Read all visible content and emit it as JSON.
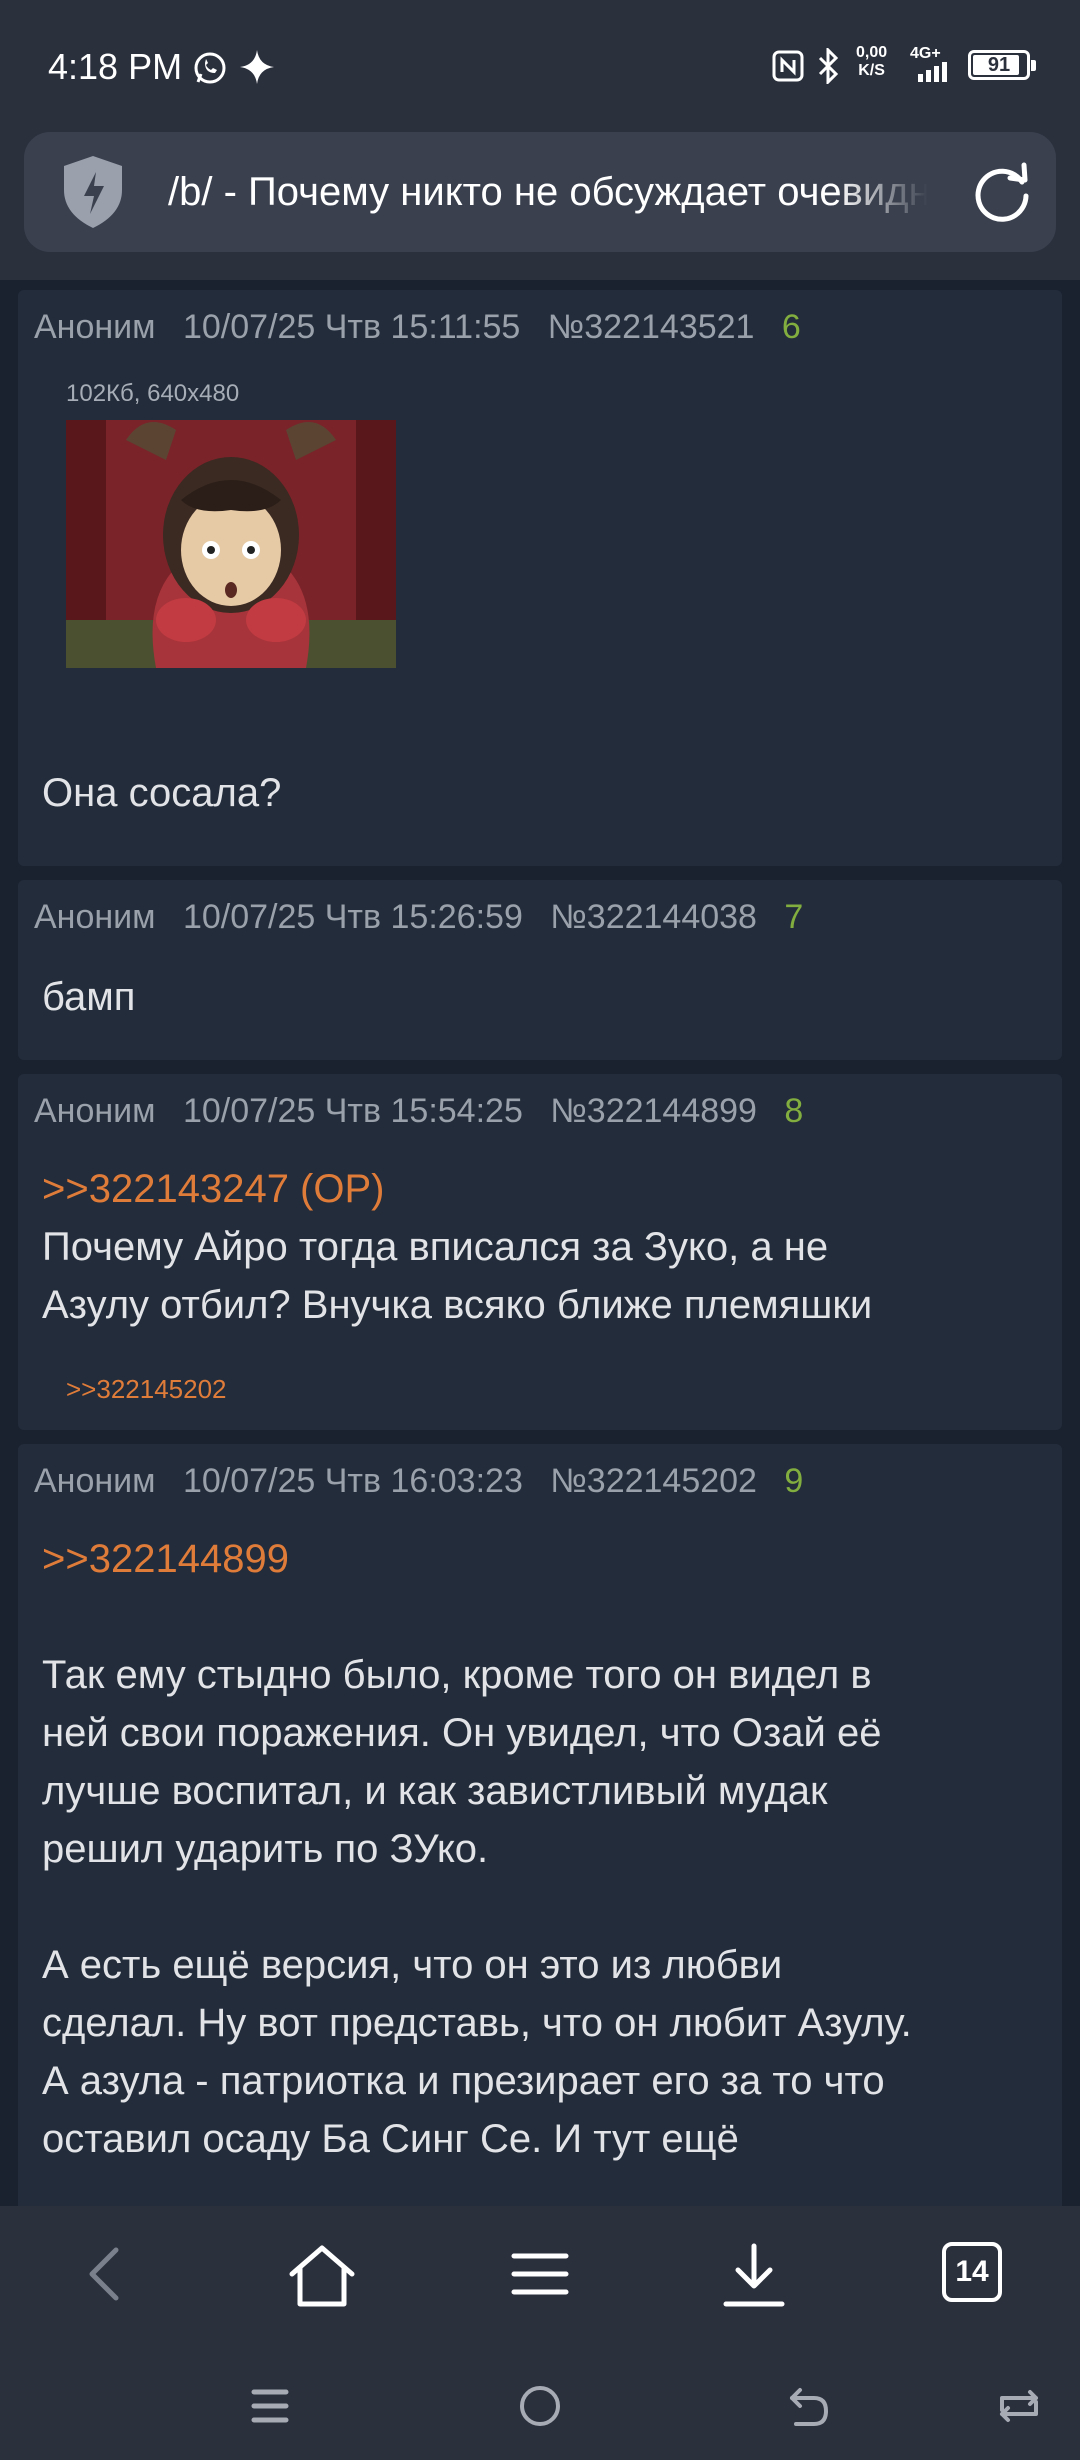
{
  "status_bar": {
    "time": "4:18 PM",
    "net_speed_value": "0,00",
    "net_speed_unit": "K/S",
    "network": "4G+",
    "battery": "91"
  },
  "urlbar": {
    "title": "/b/ - Почему никто не обсуждает очевидное"
  },
  "posts": [
    {
      "author": "Аноним",
      "date": "10/07/25 Чтв 15:11:55",
      "id": "№322143521",
      "index": "6",
      "image_info": "102Кб, 640x480",
      "text": "Она сосала?"
    },
    {
      "author": "Аноним",
      "date": "10/07/25 Чтв 15:26:59",
      "id": "№322144038",
      "index": "7",
      "text": "бамп"
    },
    {
      "author": "Аноним",
      "date": "10/07/25 Чтв 15:54:25",
      "id": "№322144899",
      "index": "8",
      "reply_to": ">>322143247 (OP)",
      "text_line1": "Почему Айро тогда вписался за Зуко, а не",
      "text_line2": "Азулу отбил? Внучка всяко ближе племяшки",
      "backlink": ">>322145202"
    },
    {
      "author": "Аноним",
      "date": "10/07/25 Чтв 16:03:23",
      "id": "№322145202",
      "index": "9",
      "reply_to": ">>322144899",
      "para1": [
        "Так ему стыдно было, кроме того он видел в",
        "ней свои поражения. Он увидел, что Озай её",
        "лучше воспитал, и как завистливый мудак",
        "решил ударить по ЗУко."
      ],
      "para2": [
        "А есть ещё версия, что он это из любви",
        "сделал. Ну вот представь, что он любит Азулу.",
        "А азула - патриотка и презирает его за то что",
        "оставил осаду Ба Синг Се. И тут ещё"
      ]
    }
  ],
  "bottom_nav": {
    "tab_count": "14"
  }
}
